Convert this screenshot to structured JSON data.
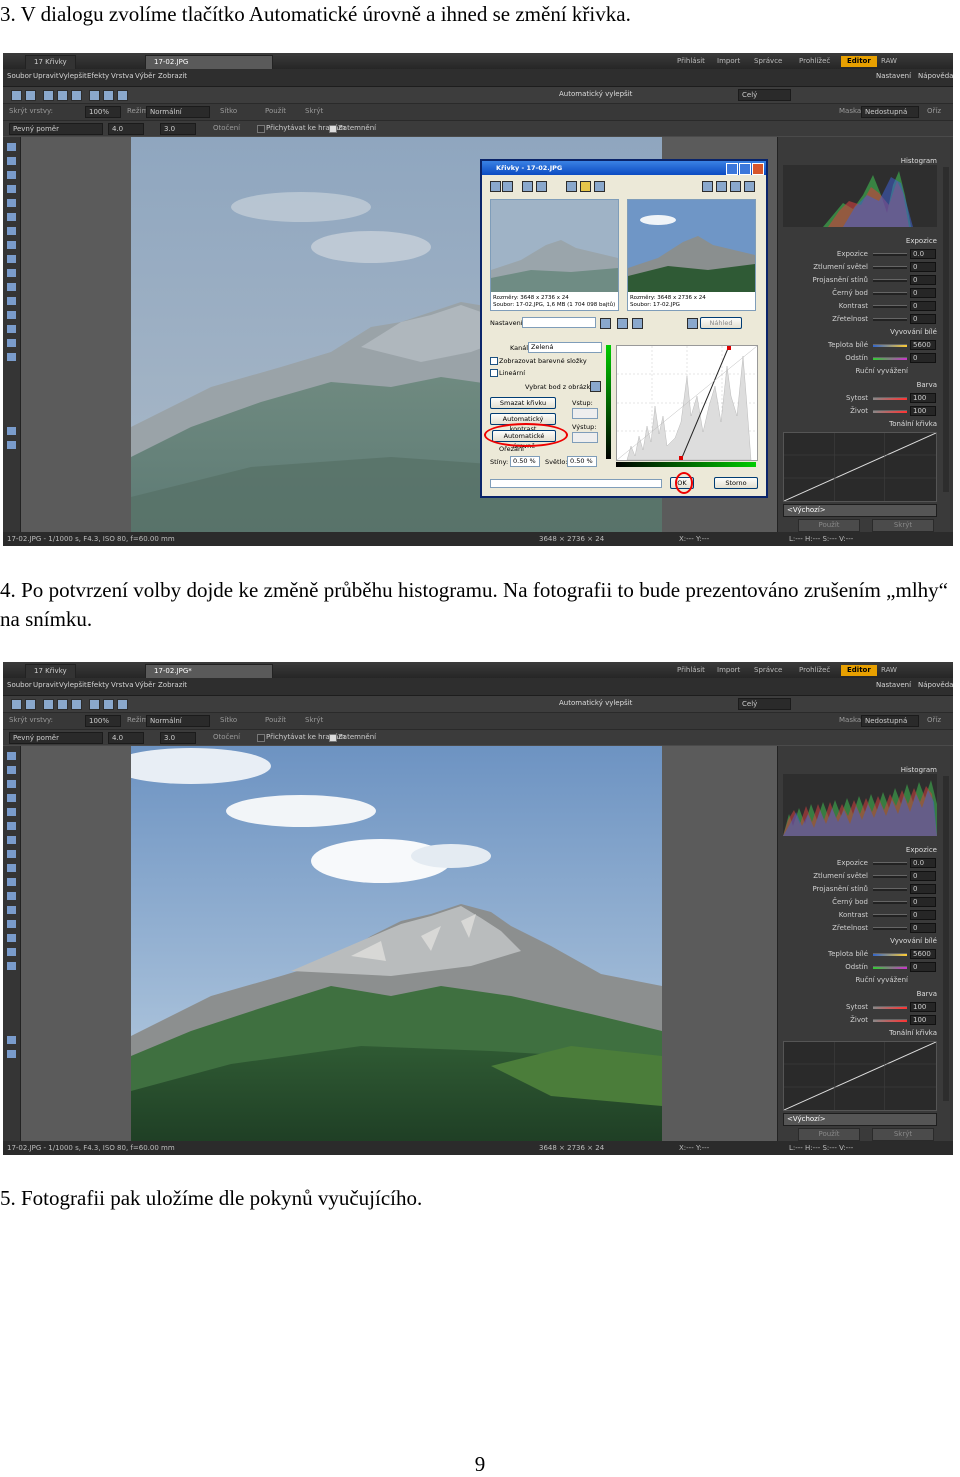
{
  "step3": "3. V dialogu zvolíme tlačítko Automatické úrovně a ihned se změní křivka.",
  "step4": "4. Po potvrzení volby dojde ke změně průběhu histogramu. Na fotografii to bude prezentováno zrušením „mlhy“ na snímku.",
  "step5": "5. Fotografii pak uložíme dle pokynů vyučujícího.",
  "page_number": "9",
  "app": {
    "tabs": [
      "17 Křivky",
      "17-02.JPG",
      "17-02.JPG*"
    ],
    "modes": [
      "Přihlásit",
      "Import",
      "Správce",
      "Prohlížeč",
      "Editor",
      "RAW"
    ],
    "menu": [
      "Soubor",
      "Upravit",
      "Vylepšit",
      "Efekty",
      "Vrstva",
      "Výběr",
      "Zobrazit"
    ],
    "toolbar1": {
      "auto_enhance": "Automatický vylepšit",
      "scope": "Celý"
    },
    "toolbar2": {
      "hide_layers": "Skrýt vrstvy:",
      "zoom": "100%",
      "mode_label": "Režim:",
      "mode_value": "Normální",
      "opacity": "Sítko",
      "apply": "Použít",
      "hide": "Skrýt",
      "mask": "Maska:",
      "mask_value": "Nedostupná",
      "clear": "Oříz"
    },
    "toolbar3": {
      "shape": "Pevný poměr",
      "w": "4.0",
      "h": "3.0",
      "rotate": "Otočení",
      "snap": "Přichytávat ke hranám",
      "highlight": "Zatemnění"
    },
    "right_top": {
      "settings": "Nastavení",
      "help": "Nápověda"
    },
    "status_left": "17-02.JPG - 1/1000 s, F4.3, ISO 80, f=60.00 mm",
    "status_mid": "3648 × 2736 × 24",
    "status_coords": "X:--- Y:---",
    "status_right": "L:--- H:--- S:--- V:---"
  },
  "panel": {
    "histogram": "Histogram",
    "exposure_header": "Expozice",
    "rows1": [
      {
        "label": "Expozice",
        "value": "0.0"
      },
      {
        "label": "Ztlumení světel",
        "value": "0"
      },
      {
        "label": "Projasnění stínů",
        "value": "0"
      },
      {
        "label": "Černý bod",
        "value": "0"
      },
      {
        "label": "Kontrast",
        "value": "0"
      },
      {
        "label": "Zřetelnost",
        "value": "0"
      }
    ],
    "wb_header": "Vyvování bílé",
    "rows2": [
      {
        "label": "Teplota bílé",
        "value": "5600"
      },
      {
        "label": "Odstín",
        "value": "0"
      }
    ],
    "manual_wb": "Ruční vyvážení",
    "color_header": "Barva",
    "rows3": [
      {
        "label": "Sytost",
        "value": "100"
      },
      {
        "label": "Život",
        "value": "100"
      }
    ],
    "curve_header": "Tonální křivka",
    "preset": "<Výchozí>",
    "apply": "Použít",
    "hide": "Skrýt"
  },
  "dialog": {
    "title": "Křivky - 17-02.JPG",
    "preview1": [
      "Rozměry: 3648 x 2736 x 24",
      "Soubor: 17-02.JPG, 1,6 MB (1 704 098 bajtů)"
    ],
    "preview2": [
      "Rozměry: 3648 x 2736 x 24",
      "Soubor: 17-02.JPG"
    ],
    "settings_label": "Nastavení:",
    "preview_btn": "Náhled",
    "channel_label": "Kanál:",
    "channel_value": "Zelená",
    "show_color": "Zobrazovat barevné složky",
    "linear": "Lineární",
    "pick_point": "Vybrat bod z obrázku:",
    "input": "Vstup:",
    "output": "Výstup:",
    "reset_btn": "Smazat křivku",
    "auto_contrast": "Automatický kontrast",
    "auto_levels": "Automatické úrovně",
    "clip": "Ořezání",
    "shadows_label": "Stíny:",
    "shadows_value": "0.50 %",
    "highlights_label": "Světlo:",
    "highlights_value": "0.50 %",
    "ok": "OK",
    "cancel": "Storno"
  },
  "colors": {
    "accent": "#e8a000",
    "dialog_title": "#0b4bc2",
    "highlight_circle": "#e00000"
  }
}
